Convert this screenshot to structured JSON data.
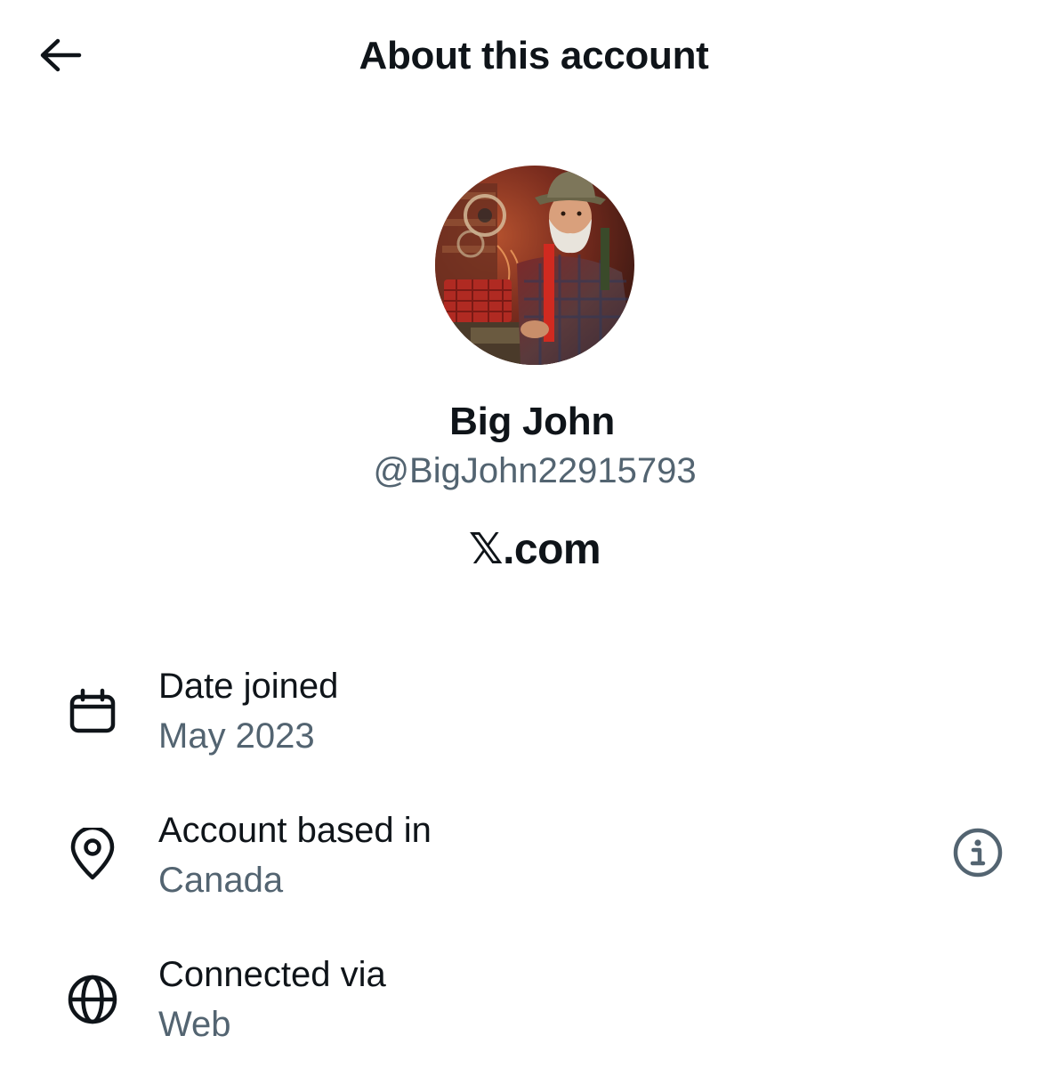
{
  "header": {
    "title": "About this account",
    "back_icon": "arrow-left-icon"
  },
  "profile": {
    "display_name": "Big John",
    "handle": "@BigJohn22915793",
    "platform": "X.com",
    "platform_glyph": "𝕏",
    "platform_suffix": ".com"
  },
  "details": [
    {
      "icon": "calendar-icon",
      "label": "Date joined",
      "value": "May 2023"
    },
    {
      "icon": "location-pin-icon",
      "label": "Account based in",
      "value": "Canada",
      "has_info": true
    },
    {
      "icon": "globe-icon",
      "label": "Connected via",
      "value": "Web"
    }
  ],
  "colors": {
    "text_primary": "#0f1419",
    "text_secondary": "#536471",
    "background": "#ffffff"
  }
}
